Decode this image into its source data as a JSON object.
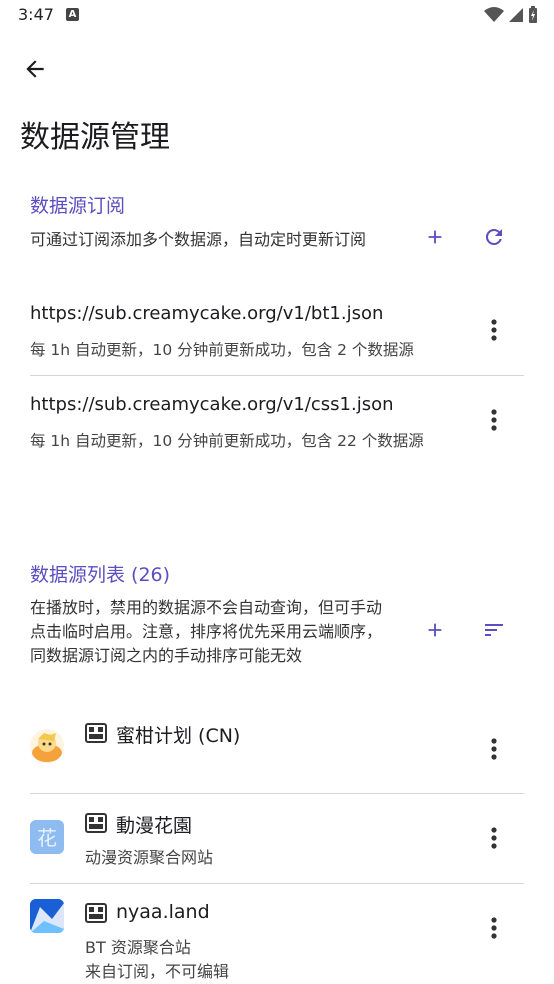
{
  "status_bar": {
    "time": "3:47",
    "badge": "A"
  },
  "page": {
    "title": "数据源管理"
  },
  "subscriptions": {
    "title": "数据源订阅",
    "description": "可通过订阅添加多个数据源，自动定时更新订阅",
    "items": [
      {
        "url": "https://sub.creamycake.org/v1/bt1.json",
        "status": "每 1h 自动更新，10 分钟前更新成功，包含 2 个数据源"
      },
      {
        "url": "https://sub.creamycake.org/v1/css1.json",
        "status": "每 1h 自动更新，10 分钟前更新成功，包含 22 个数据源"
      }
    ]
  },
  "sources": {
    "title": "数据源列表 (26)",
    "description": "在播放时，禁用的数据源不会自动查询，但可手动点击临时启用。注意，排序将优先采用云端顺序，同数据源订阅之内的手动排序可能无效",
    "items": [
      {
        "name": "蜜柑计划 (CN)",
        "desc": ""
      },
      {
        "name": "動漫花園",
        "desc": "动漫资源聚合网站"
      },
      {
        "name": "nyaa.land",
        "desc": "BT 资源聚合站",
        "note": "来自订阅，不可编辑"
      }
    ]
  },
  "colors": {
    "accent": "#5b4fc0",
    "text": "#1c1b1f",
    "divider": "#d6d3da"
  }
}
